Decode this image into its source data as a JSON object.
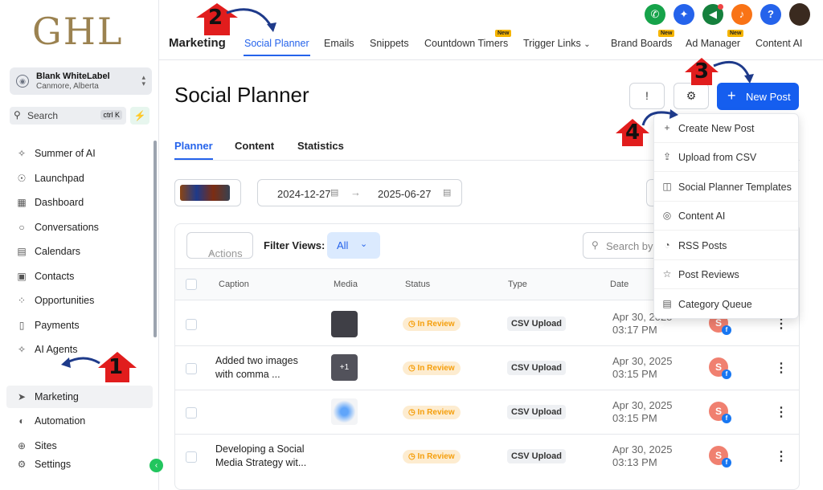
{
  "brand": {
    "logo_text": "GHL"
  },
  "account": {
    "name": "Blank WhiteLabel",
    "location": "Canmore, Alberta"
  },
  "search": {
    "label": "Search",
    "shortcut": "ctrl K"
  },
  "sidebar": {
    "items": [
      {
        "label": "Summer of AI",
        "icon": "sparkle-icon"
      },
      {
        "label": "Launchpad",
        "icon": "rocket-icon"
      },
      {
        "label": "Dashboard",
        "icon": "grid-icon"
      },
      {
        "label": "Conversations",
        "icon": "chat-icon"
      },
      {
        "label": "Calendars",
        "icon": "calendar-icon"
      },
      {
        "label": "Contacts",
        "icon": "contacts-icon"
      },
      {
        "label": "Opportunities",
        "icon": "funnel-icon"
      },
      {
        "label": "Payments",
        "icon": "receipt-icon"
      },
      {
        "label": "AI Agents",
        "icon": "sparkle-icon"
      },
      {
        "label": "Marketing",
        "icon": "send-icon"
      },
      {
        "label": "Automation",
        "icon": "automation-icon"
      },
      {
        "label": "Sites",
        "icon": "globe-icon"
      },
      {
        "label": "Settings",
        "icon": "gear-icon"
      }
    ],
    "active": "Marketing"
  },
  "topbar": {
    "section_title": "Marketing",
    "tabs": [
      {
        "label": "Social Planner",
        "active": true
      },
      {
        "label": "Emails"
      },
      {
        "label": "Snippets"
      },
      {
        "label": "Countdown Timers",
        "badge": "New"
      },
      {
        "label": "Trigger Links"
      },
      {
        "label": "Brand Boards",
        "badge": "New"
      },
      {
        "label": "Ad Manager",
        "badge": "New"
      },
      {
        "label": "Content AI"
      }
    ],
    "icon_colors": {
      "phone": "#16a34a",
      "magic": "#2563eb",
      "megaphone": "#15803d",
      "bell": "#f97316",
      "help": "#2563eb"
    }
  },
  "page": {
    "title": "Social Planner",
    "new_post_label": "New Post",
    "subtabs": [
      {
        "label": "Planner",
        "active": true
      },
      {
        "label": "Content"
      },
      {
        "label": "Statistics"
      }
    ],
    "date_start": "2024-12-27",
    "date_end": "2025-06-27"
  },
  "filters": {
    "actions_label": "Actions",
    "filter_views_label": "Filter Views:",
    "filter_value": "All",
    "search_placeholder": "Search by"
  },
  "table": {
    "columns": [
      "Caption",
      "Media",
      "Status",
      "Type",
      "Date"
    ],
    "rows": [
      {
        "caption": "",
        "status": "In Review",
        "type": "CSV Upload",
        "date": "Apr 30, 2025",
        "time": "03:17 PM",
        "avatar": "S"
      },
      {
        "caption": "Added two images with comma ...",
        "status": "In Review",
        "type": "CSV Upload",
        "date": "Apr 30, 2025",
        "time": "03:15 PM",
        "avatar": "S",
        "media_count": "+1"
      },
      {
        "caption": "",
        "status": "In Review",
        "type": "CSV Upload",
        "date": "Apr 30, 2025",
        "time": "03:15 PM",
        "avatar": "S"
      },
      {
        "caption": "Developing a Social Media Strategy wit...",
        "status": "In Review",
        "type": "CSV Upload",
        "date": "Apr 30, 2025",
        "time": "03:13 PM",
        "avatar": "S"
      }
    ]
  },
  "dropdown": {
    "items": [
      {
        "label": "Create New Post",
        "icon": "plus-icon"
      },
      {
        "label": "Upload from CSV",
        "icon": "upload-icon"
      },
      {
        "label": "Social Planner Templates",
        "icon": "template-icon"
      },
      {
        "label": "Content AI",
        "icon": "robot-icon"
      },
      {
        "label": "RSS Posts",
        "icon": "rss-icon"
      },
      {
        "label": "Post Reviews",
        "icon": "star-icon"
      },
      {
        "label": "Category Queue",
        "icon": "queue-icon"
      }
    ]
  },
  "annotations": {
    "steps": [
      "1",
      "2",
      "3",
      "4"
    ],
    "marker_color": "#e11d1d",
    "arrow_color": "#1e3a8a"
  }
}
